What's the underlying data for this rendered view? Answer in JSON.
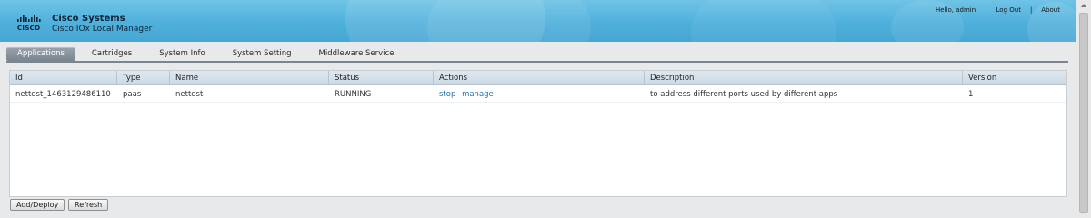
{
  "header": {
    "company": "Cisco Systems",
    "product": "Cisco IOx Local Manager",
    "logo_text": "CISCO",
    "greeting": "Hello, admin",
    "logout_label": "Log Out",
    "about_label": "About",
    "separator": "|"
  },
  "tabs": [
    {
      "label": "Applications",
      "active": true
    },
    {
      "label": "Cartridges",
      "active": false
    },
    {
      "label": "System Info",
      "active": false
    },
    {
      "label": "System Setting",
      "active": false
    },
    {
      "label": "Middleware Service",
      "active": false
    }
  ],
  "table": {
    "columns": [
      "Id",
      "Type",
      "Name",
      "Status",
      "Actions",
      "Description",
      "Version"
    ],
    "rows": [
      {
        "id": "nettest_1463129486110",
        "type": "paas",
        "name": "nettest",
        "status": "RUNNING",
        "actions": [
          "stop",
          "manage"
        ],
        "description": "to address different ports used by different apps",
        "version": "1"
      }
    ]
  },
  "buttons": {
    "add_deploy": "Add/Deploy",
    "refresh": "Refresh"
  },
  "colors": {
    "header_blue": "#4fb0dc",
    "active_tab": "#7b858f",
    "link": "#1b6fb0"
  }
}
